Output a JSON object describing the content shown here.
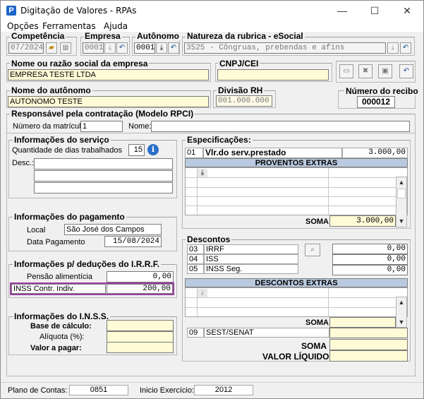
{
  "window": {
    "title": "Digitação de Valores - RPAs",
    "app_icon": "P",
    "minimize": "—",
    "maximize": "☐",
    "close": "✕"
  },
  "menu": [
    "Opções",
    "Ferramentas",
    "Ajuda"
  ],
  "competencia": {
    "label": "Competência",
    "value": "07/2024"
  },
  "empresa": {
    "label": "Empresa",
    "value": "0001"
  },
  "autonomo": {
    "label": "Autônomo",
    "value": "0001"
  },
  "natureza": {
    "label": "Natureza da rubrica - eSocial",
    "value": "3525 - Côngruas, prebendas e afins"
  },
  "razao_social": {
    "label": "Nome ou razão social da empresa",
    "value": "EMPRESA TESTE LTDA"
  },
  "cnpj": {
    "label": "CNPJ/CEI",
    "value": ""
  },
  "nome_autonomo": {
    "label": "Nome do autônomo",
    "value": "AUTONOMO TESTE"
  },
  "divisao_rh": {
    "label": "Divisão RH",
    "value": "001.000.000"
  },
  "numero_recibo": {
    "label": "Número do recibo",
    "value": "000012"
  },
  "responsavel": {
    "label": "Responsável pela contratação (Modelo RPCI)",
    "matricula_label": "Número da matrícula:",
    "matricula_value": "1",
    "nome_label": "Nome:",
    "nome_value": ""
  },
  "servico": {
    "label": "Informações do serviço",
    "dias_label": "Quantidade de dias trabalhados",
    "dias_value": "15",
    "desc_label": "Desc.:",
    "desc_lines": [
      "",
      "",
      ""
    ]
  },
  "pagamento": {
    "label": "Informações do pagamento",
    "local_label": "Local",
    "local_value": "São José dos Campos",
    "data_label": "Data Pagamento",
    "data_value": "15/08/2024"
  },
  "irrf": {
    "label": "Informações p/ deduções do I.R.R.F.",
    "pensao_label": "Pensão alimentícia",
    "pensao_value": "0,00",
    "inss_label": "INSS Contr. Indiv.",
    "inss_value": "200,00"
  },
  "inss": {
    "label": "Informações do I.N.S.S.",
    "base_label": "Base de cálculo:",
    "aliquota_label": "Alíquota (%):",
    "valor_label": "Valor a pagar:",
    "base_value": "",
    "aliquota_value": "",
    "valor_value": ""
  },
  "especificacoes": {
    "label": "Especificações:",
    "code": "01",
    "desc": "Vlr.do serv.prestado",
    "value": "3.000,00",
    "proventos_header": "PROVENTOS EXTRAS",
    "soma_label": "SOMA",
    "soma_value": "3.000,00"
  },
  "descontos": {
    "label": "Descontos",
    "rows": [
      {
        "code": "03",
        "name": "IRRF",
        "value": "0,00"
      },
      {
        "code": "04",
        "name": "ISS",
        "value": "0,00"
      },
      {
        "code": "05",
        "name": "INSS Seg.",
        "value": "0,00"
      }
    ],
    "extras_header": "DESCONTOS EXTRAS",
    "soma_label": "SOMA",
    "soma_value": "",
    "sest_code": "09",
    "sest_name": "SEST/SENAT",
    "sest_value": "",
    "total_soma_label": "SOMA",
    "total_soma_value": "",
    "liquido_label": "VALOR LÍQUIDO",
    "liquido_value": ""
  },
  "status": {
    "plano_label": "Plano de Contas:",
    "plano_value": "0851",
    "inicio_label": "Inicio Exercício:",
    "inicio_value": "2012"
  },
  "colors": {
    "highlight_border": "#9b3ea3",
    "grid_header": "#b9c9e0",
    "yellow_field": "#fffbd6"
  }
}
